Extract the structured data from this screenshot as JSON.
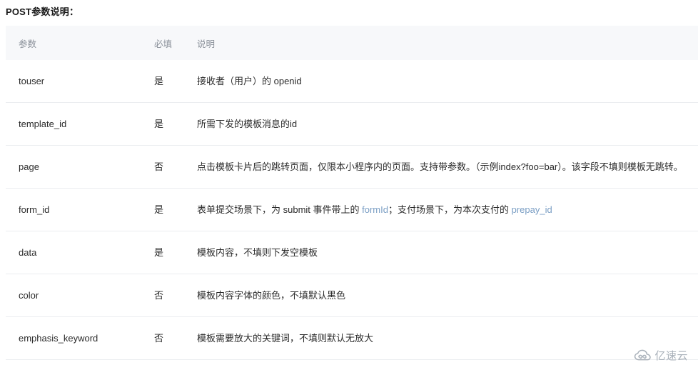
{
  "page": {
    "title": "POST参数说明："
  },
  "table": {
    "headers": {
      "name": "参数",
      "required": "必填",
      "description": "说明"
    },
    "rows": [
      {
        "name": "touser",
        "required": "是",
        "description": "接收者（用户）的 openid"
      },
      {
        "name": "template_id",
        "required": "是",
        "description": "所需下发的模板消息的id"
      },
      {
        "name": "page",
        "required": "否",
        "description": "点击模板卡片后的跳转页面，仅限本小程序内的页面。支持带参数。（示例index?foo=bar）。该字段不填则模板无跳转。"
      },
      {
        "name": "form_id",
        "required": "是",
        "desc_part1": "表单提交场景下，为 submit 事件带上的 ",
        "link1": "formId",
        "desc_part2": "；支付场景下，为本次支付的 ",
        "link2": "prepay_id"
      },
      {
        "name": "data",
        "required": "是",
        "description": "模板内容，不填则下发空模板"
      },
      {
        "name": "color",
        "required": "否",
        "description": "模板内容字体的颜色，不填默认黑色"
      },
      {
        "name": "emphasis_keyword",
        "required": "否",
        "description": "模板需要放大的关键词，不填则默认无放大"
      }
    ]
  },
  "watermark": {
    "text": "亿速云",
    "icon": "cloud-icon"
  },
  "colors": {
    "link": "#7a9ec4",
    "header_bg": "#f7f8fa",
    "header_text": "#8a9099",
    "border": "#ebedf0",
    "watermark_text": "#9aa3ad"
  }
}
